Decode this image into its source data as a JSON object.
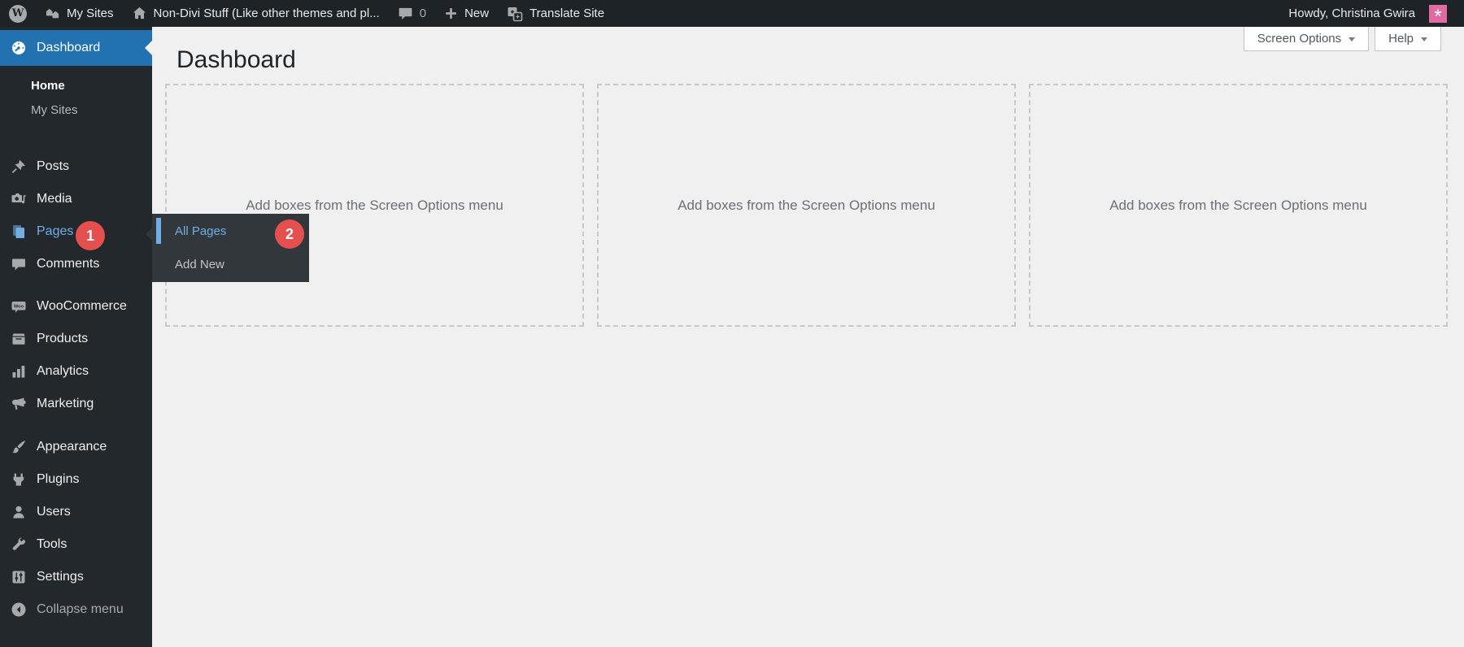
{
  "admin_bar": {
    "wp_logo_letter": "W",
    "my_sites_label": "My Sites",
    "site_name": "Non-Divi Stuff (Like other themes and pl...",
    "comments_count": "0",
    "new_label": "New",
    "translate_label": "Translate Site",
    "howdy_text": "Howdy, Christina Gwira",
    "avatar_glyph": "*"
  },
  "sidebar": {
    "dashboard_label": "Dashboard",
    "dashboard_submenu": [
      {
        "label": "Home"
      },
      {
        "label": "My Sites"
      }
    ],
    "groups": [
      {
        "items": [
          {
            "label": "Posts"
          },
          {
            "label": "Media"
          },
          {
            "label": "Pages",
            "badge": "1"
          },
          {
            "label": "Comments"
          }
        ]
      },
      {
        "items": [
          {
            "label": "WooCommerce"
          },
          {
            "label": "Products"
          },
          {
            "label": "Analytics"
          },
          {
            "label": "Marketing"
          }
        ]
      },
      {
        "items": [
          {
            "label": "Appearance"
          },
          {
            "label": "Plugins"
          },
          {
            "label": "Users"
          },
          {
            "label": "Tools"
          },
          {
            "label": "Settings"
          }
        ]
      }
    ],
    "collapse_label": "Collapse menu"
  },
  "flyout": {
    "items": [
      {
        "label": "All Pages",
        "badge": "2"
      },
      {
        "label": "Add New"
      }
    ]
  },
  "main": {
    "title": "Dashboard",
    "screen_options_label": "Screen Options",
    "help_label": "Help",
    "placeholder_text": "Add boxes from the Screen Options menu"
  },
  "colors": {
    "accent_blue": "#2271b1",
    "link_blue": "#72aee6",
    "badge_red": "#e5504e",
    "avatar_pink": "#e26aa4",
    "admin_bar_bg": "#1d2327",
    "sidebar_bg": "#23282d",
    "flyout_bg": "#32373c",
    "content_bg": "#f0f0f1"
  }
}
